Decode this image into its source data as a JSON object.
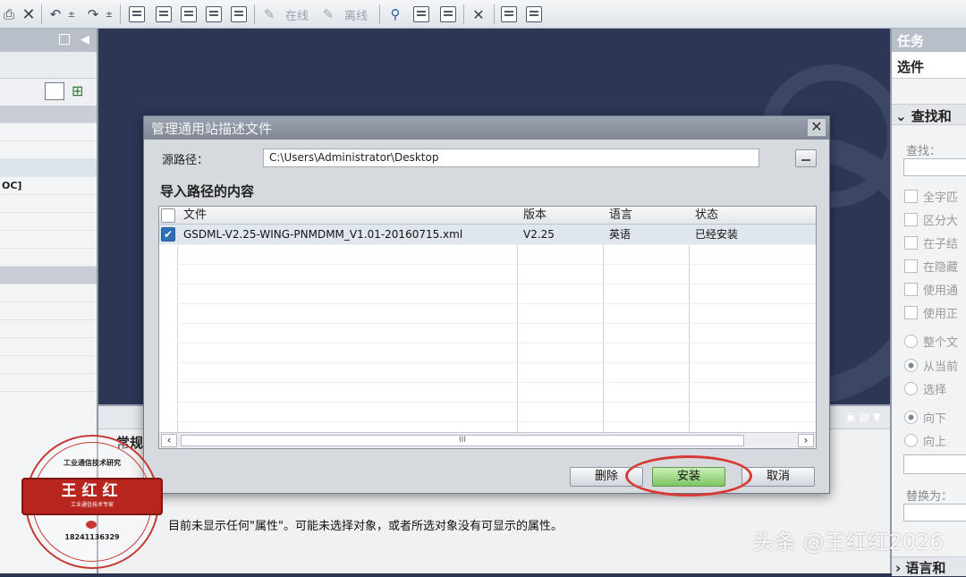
{
  "toolbar": {
    "online_label": "在线",
    "offline_label": "离线"
  },
  "left_panel": {
    "row_fragment": "OC]"
  },
  "right_panel": {
    "title": "任务",
    "select_label": "选件",
    "find_section": "查找和",
    "find_label": "查找：",
    "checkboxes": [
      "全字匹",
      "区分大",
      "在子结",
      "在隐藏",
      "使用通",
      "使用正"
    ],
    "radios_scope": [
      "整个文",
      "从当前",
      "选择"
    ],
    "radios_dir": [
      "向下",
      "向上"
    ],
    "replace_label": "替换为：",
    "lang_section": "语言和"
  },
  "bottom": {
    "tab_label": "常规",
    "message": "目前未显示任何\"属性\"。可能未选择对象，或者所选对象没有可显示的属性。"
  },
  "dialog": {
    "title": "管理通用站描述文件",
    "source_label": "源路径：",
    "source_path": "C:\\Users\\Administrator\\Desktop",
    "content_title": "导入路径的内容",
    "columns": [
      "文件",
      "版本",
      "语言",
      "状态"
    ],
    "rows": [
      {
        "file": "GSDML-V2.25-WING-PNMDMM_V1.01-20160715.xml",
        "version": "V2.25",
        "language": "英语",
        "status": "已经安装",
        "checked": true
      }
    ],
    "scroll_thumb": "III",
    "buttons": {
      "delete": "删除",
      "install": "安装",
      "cancel": "取消"
    },
    "highlight_color": "#d73a35"
  },
  "stamp": {
    "top_text": "工业通信技术研究",
    "name": "王红红",
    "sub_text": "工业通信技术专家",
    "phone": "18241136329"
  },
  "watermark": "头条 @王红红2026"
}
